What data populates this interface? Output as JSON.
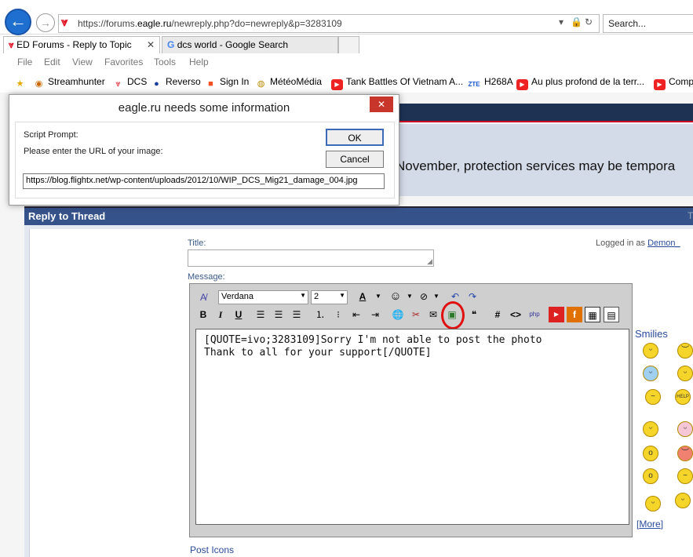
{
  "browser": {
    "url_prefix": "https://forums.",
    "url_host": "eagle.ru",
    "url_path": "/newreply.php?do=newreply&p=3283109",
    "search_placeholder": "Search...",
    "tabs": [
      {
        "label": "ED Forums - Reply to Topic",
        "close": "✕"
      },
      {
        "label": "dcs world - Google Search"
      }
    ],
    "menu": [
      "File",
      "Edit",
      "View",
      "Favorites",
      "Tools",
      "Help"
    ],
    "favorites": [
      "Streamhunter",
      "DCS",
      "Reverso",
      "Sign In",
      "MétéoMédia",
      "Tank Battles Of Vietnam A...",
      "H268A",
      "Au plus profond de la terr...",
      "Comp"
    ],
    "zte_label": "ZTE"
  },
  "dialog": {
    "title": "eagle.ru needs some information",
    "close": "✕",
    "script_prompt": "Script Prompt:",
    "prompt_text": "Please enter the URL of your image:",
    "ok_label": "OK",
    "cancel_label": "Cancel",
    "input_value": "https://blog.flightx.net/wp-content/uploads/2012/10/WIP_DCS_Mig21_damage_004.jpg"
  },
  "forum": {
    "notice_text": "November, protection services may be tempora",
    "thread_header": "Reply to Thread",
    "thread_header_right": "T",
    "title_label": "Title:",
    "logged_in_label": "Logged in as ",
    "logged_in_user": "Demon_",
    "message_label": "Message:",
    "font_name": "Verdana",
    "font_size": "2",
    "message_text": "[QUOTE=ivo;3283109]Sorry I'm not able to post the photo\nThank to all for your support[/QUOTE]",
    "smilies_title": "Smilies",
    "more_label": "More",
    "post_icons_label": "Post Icons"
  },
  "colors": {
    "highlight_circle": "#e01010",
    "thread_header_bg": "#36528a",
    "link": "#2a4a9a"
  }
}
